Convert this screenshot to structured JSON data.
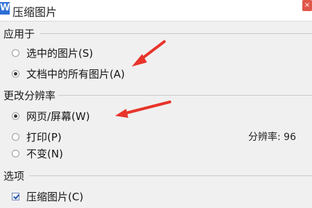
{
  "window": {
    "app_icon_letter": "W",
    "title": "压缩图片",
    "close_glyph": "×"
  },
  "apply_to": {
    "heading": "应用于",
    "options": [
      {
        "label": "选中的图片(S)",
        "selected": false
      },
      {
        "label": "文档中的所有图片(A)",
        "selected": true
      }
    ]
  },
  "resolution": {
    "heading": "更改分辨率",
    "options": [
      {
        "label": "网页/屏幕(W)",
        "selected": true
      },
      {
        "label": "打印(P)",
        "selected": false
      },
      {
        "label": "不变(N)",
        "selected": false
      }
    ],
    "value_label": "分辨率: 96"
  },
  "options": {
    "heading": "选项",
    "checkboxes": [
      {
        "label": "压缩图片(C)",
        "checked": true
      }
    ]
  },
  "colors": {
    "annotation_arrow": "#e8342a",
    "accent": "#2d6fd6"
  }
}
